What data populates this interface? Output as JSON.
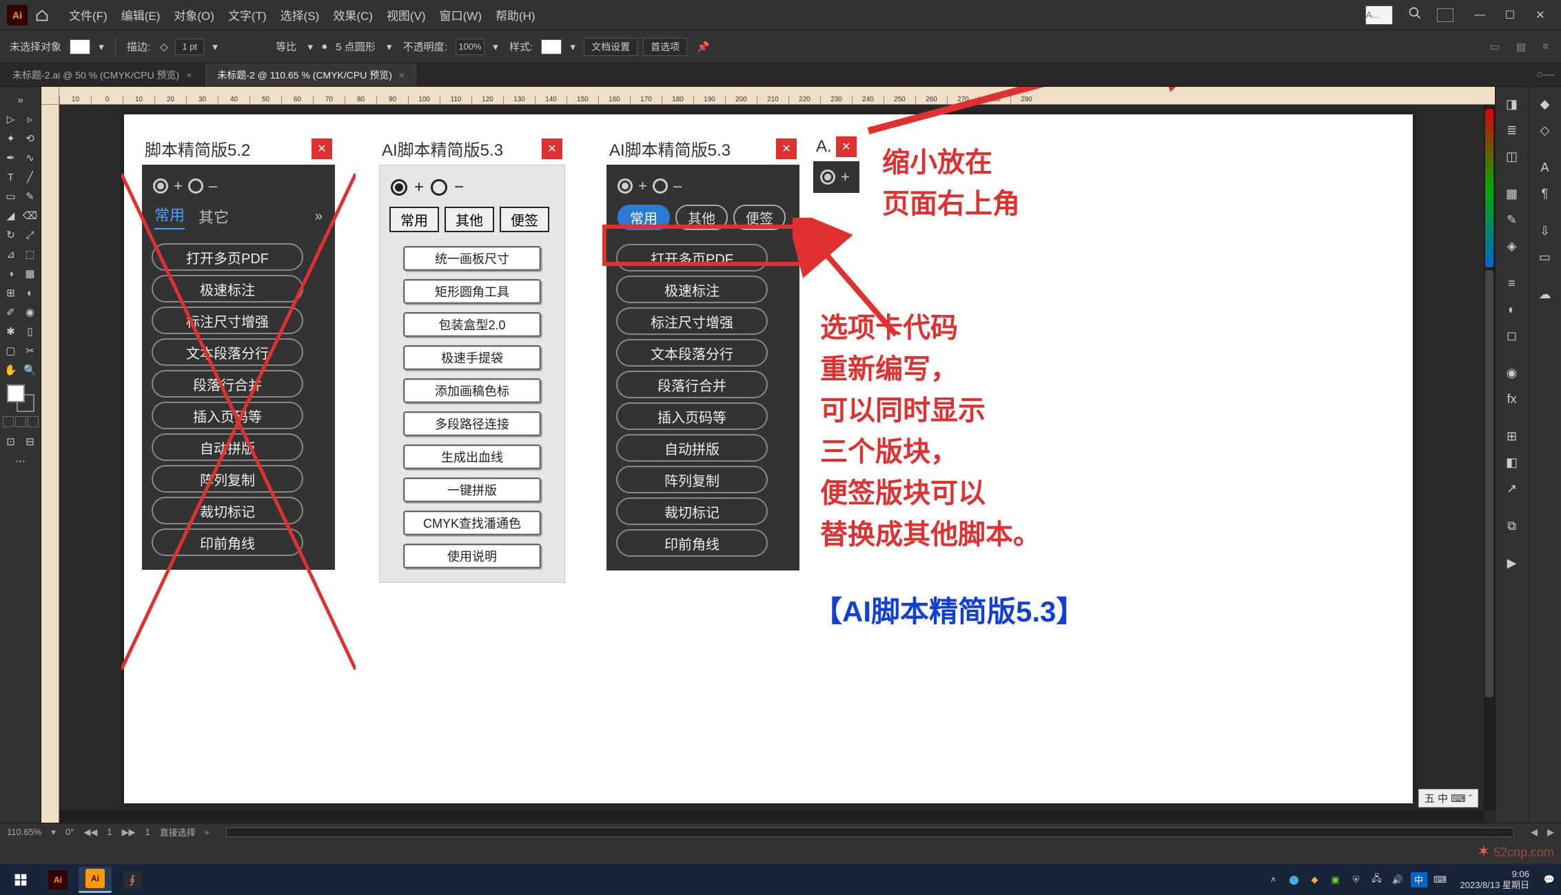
{
  "menubar": {
    "items": [
      "文件(F)",
      "编辑(E)",
      "对象(O)",
      "文字(T)",
      "选择(S)",
      "效果(C)",
      "视图(V)",
      "窗口(W)",
      "帮助(H)"
    ],
    "workspace_placeholder": "A..."
  },
  "options": {
    "no_selection": "未选择对象",
    "stroke": "描边:",
    "stroke_val": "1 pt",
    "uniform": "等比",
    "brush": "5 点圆形",
    "opacity_label": "不透明度:",
    "opacity_val": "100%",
    "style": "样式:",
    "doc_setup": "文档设置",
    "prefs": "首选项"
  },
  "doc_tabs": [
    {
      "label": "未标题-2.ai @ 50 % (CMYK/CPU 预览)",
      "active": false
    },
    {
      "label": "未标题-2 @ 110.65 % (CMYK/CPU 预览)",
      "active": true
    }
  ],
  "ruler_ticks": [
    "10",
    "0",
    "10",
    "20",
    "30",
    "40",
    "50",
    "60",
    "70",
    "80",
    "90",
    "100",
    "110",
    "120",
    "130",
    "140",
    "150",
    "160",
    "170",
    "180",
    "190",
    "200",
    "210",
    "220",
    "230",
    "240",
    "250",
    "260",
    "270",
    "280",
    "290"
  ],
  "panel_52": {
    "title": "脚本精简版5.2",
    "tabs": [
      "常用",
      "其它"
    ],
    "buttons": [
      "打开多页PDF",
      "极速标注",
      "标注尺寸增强",
      "文本段落分行",
      "段落行合并",
      "插入页码等",
      "自动拼版",
      "阵列复制",
      "裁切标记",
      "印前角线"
    ]
  },
  "panel_53_light": {
    "title": "AI脚本精简版5.3",
    "tabs": [
      "常用",
      "其他",
      "便签"
    ],
    "buttons": [
      "统一画板尺寸",
      "矩形圆角工具",
      "包装盒型2.0",
      "极速手提袋",
      "添加画稿色标",
      "多段路径连接",
      "生成出血线",
      "一键拼版",
      "CMYK查找潘通色",
      "使用说明"
    ]
  },
  "panel_53_dark": {
    "title": "AI脚本精简版5.3",
    "tabs": [
      "常用",
      "其他",
      "便签"
    ],
    "buttons": [
      "打开多页PDF",
      "极速标注",
      "标注尺寸增强",
      "文本段落分行",
      "段落行合并",
      "插入页码等",
      "自动拼版",
      "阵列复制",
      "裁切标记",
      "印前角线"
    ]
  },
  "panel_mini": {
    "title": "A."
  },
  "annotations": {
    "arrow1": "缩小放在\n页面右上角",
    "arrow2": "选项卡代码\n重新编写，\n可以同时显示\n三个版块，\n便签版块可以\n替换成其他脚本。",
    "bracket_title": "【AI脚本精简版5.3】"
  },
  "status": {
    "zoom": "110.65%",
    "nav": "1",
    "range": "1",
    "tool": "直接选择"
  },
  "ime_box": "五 中 ⌨ ˇ",
  "taskbar": {
    "time": "9:06",
    "date": "2023/8/13 星期日"
  },
  "watermark": "52cnp.com"
}
